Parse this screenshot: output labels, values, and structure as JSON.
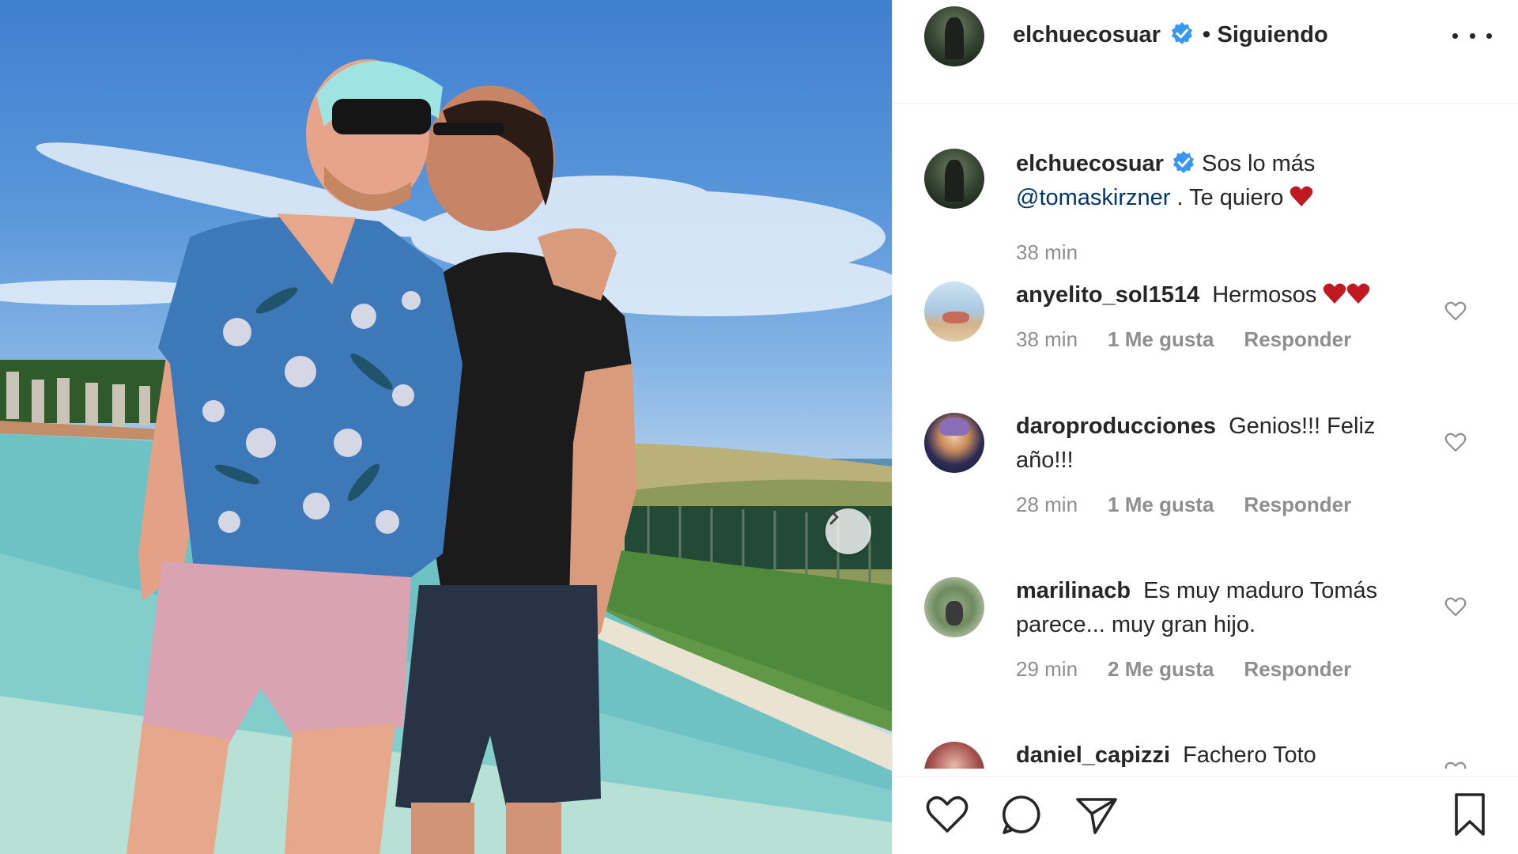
{
  "post": {
    "carousel_next": "next-arrow"
  },
  "header": {
    "username": "elchuecosuar",
    "separator": "•",
    "follow_status": "Siguiendo",
    "menu_icon": "more-dots-icon"
  },
  "caption": {
    "username": "elchuecosuar",
    "text_part1": "Sos lo más",
    "mention": "@tomaskirzner",
    "text_part2": ". Te quiero",
    "time": "38 min"
  },
  "comments": [
    {
      "username": "anyelito_sol1514",
      "text": "Hermosos",
      "time": "38 min",
      "likes": "1 Me gusta",
      "reply": "Responder"
    },
    {
      "username": "daroproducciones",
      "text": "Genios!!! Feliz año!!!",
      "time": "28 min",
      "likes": "1 Me gusta",
      "reply": "Responder"
    },
    {
      "username": "marilinacb",
      "text": "Es muy maduro Tomás parece... muy gran hijo.",
      "time": "29 min",
      "likes": "2 Me gusta",
      "reply": "Responder"
    },
    {
      "username": "daniel_capizzi",
      "text": "Fachero Toto"
    }
  ],
  "actions": {
    "like": "heart-icon",
    "comment": "comment-icon",
    "share": "send-icon",
    "save": "bookmark-icon"
  },
  "colors": {
    "verified": "#3897f0",
    "heart_red": "#c0191f",
    "mention": "#00376b",
    "muted": "#8e8e8e"
  }
}
